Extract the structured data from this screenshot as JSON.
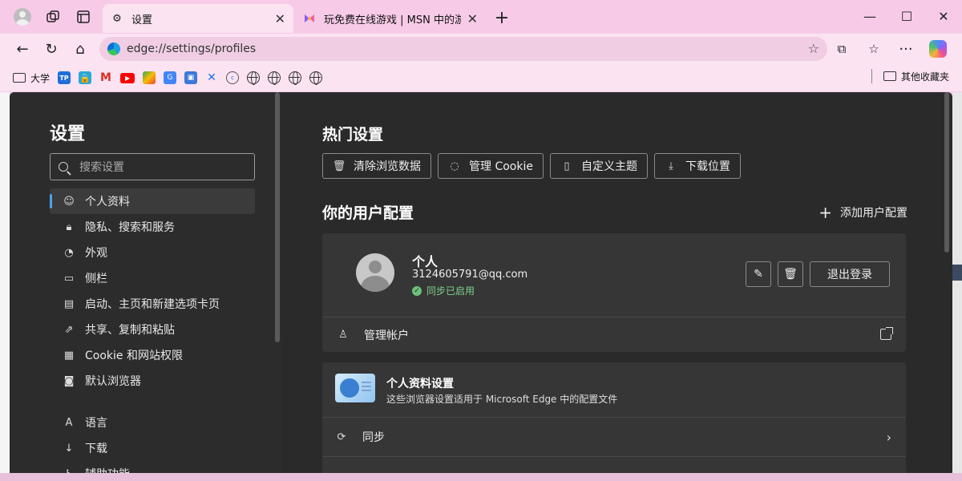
{
  "tabs": [
    {
      "title": "设置",
      "icon": "gear-icon",
      "active": true
    },
    {
      "title": "玩免费在线游戏 | MSN 中的游戏",
      "icon": "msn-games-icon",
      "active": false
    }
  ],
  "address": {
    "url": "edge://settings/profiles"
  },
  "bookmarks": {
    "first_label": "大学",
    "other_label": "其他收藏夹"
  },
  "sidebar": {
    "title": "设置",
    "search_placeholder": "搜索设置",
    "items": [
      {
        "label": "个人资料"
      },
      {
        "label": "隐私、搜索和服务"
      },
      {
        "label": "外观"
      },
      {
        "label": "侧栏"
      },
      {
        "label": "启动、主页和新建选项卡页"
      },
      {
        "label": "共享、复制和粘贴"
      },
      {
        "label": "Cookie 和网站权限"
      },
      {
        "label": "默认浏览器"
      },
      {
        "label": "语言"
      },
      {
        "label": "下载"
      },
      {
        "label": "辅助功能"
      }
    ]
  },
  "main": {
    "hot_title": "热门设置",
    "quick": [
      {
        "label": "清除浏览数据"
      },
      {
        "label": "管理 Cookie"
      },
      {
        "label": "自定义主题"
      },
      {
        "label": "下载位置"
      }
    ],
    "profiles_title": "你的用户配置",
    "add_profile": "添加用户配置",
    "profile": {
      "name": "个人",
      "email": "3124605791@qq.com",
      "sync": "同步已启用",
      "signout": "退出登录",
      "manage": "管理帐户"
    },
    "profile_settings": {
      "title": "个人资料设置",
      "desc": "这些浏览器设置适用于 Microsoft Edge 中的配置文件",
      "sync": "同步"
    }
  }
}
